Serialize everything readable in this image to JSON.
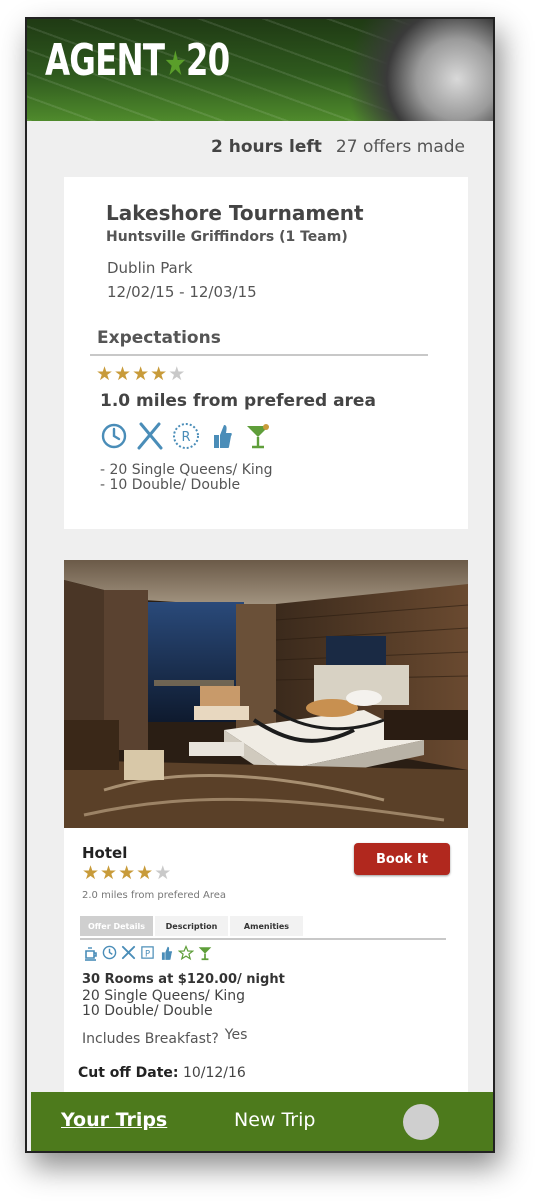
{
  "header": {
    "logo_left": "AGENT",
    "logo_star": "★",
    "logo_right": "20"
  },
  "status": {
    "time_left": "2 hours left",
    "offers": "27 offers made"
  },
  "trip": {
    "title": "Lakeshore Tournament",
    "team": "Huntsville Griffindors (1 Team)",
    "location": "Dublin Park",
    "dates": "12/02/15 - 12/03/15"
  },
  "expectations": {
    "heading": "Expectations",
    "rating": 4,
    "rating_max": 5,
    "distance": "1.0 miles from prefered area",
    "amenities": [
      "clock-icon",
      "restaurant-icon",
      "parking-icon",
      "thumbs-up-icon",
      "cocktail-icon"
    ],
    "rooms": [
      "- 20 Single Queens/ King",
      "- 10 Double/ Double"
    ]
  },
  "offer": {
    "type": "Hotel",
    "book_label": "Book It",
    "rating": 4,
    "rating_max": 5,
    "distance": "2.0 miles from prefered Area",
    "tabs": [
      "Offer Details",
      "Description",
      "Amenities"
    ],
    "active_tab": 0,
    "amenities": [
      "coffee-icon",
      "clock-icon",
      "restaurant-icon",
      "parking-icon",
      "thumbs-up-icon",
      "star-icon",
      "cocktail-icon"
    ],
    "rooms_title": "30 Rooms at $120.00/ night",
    "rooms": [
      "20 Single Queens/ King",
      "10 Double/ Double"
    ],
    "breakfast_label": "Includes Breakfast?",
    "breakfast_value": "Yes",
    "cutoff_label": "Cut off Date:",
    "cutoff_value": "10/12/16"
  },
  "footer": {
    "trips": "Your Trips",
    "new_trip": "New Trip"
  },
  "colors": {
    "brand_green": "#4d7a1c",
    "book_red": "#b1281e",
    "star_gold": "#c89b3a",
    "icon_blue": "#4a8db8"
  }
}
